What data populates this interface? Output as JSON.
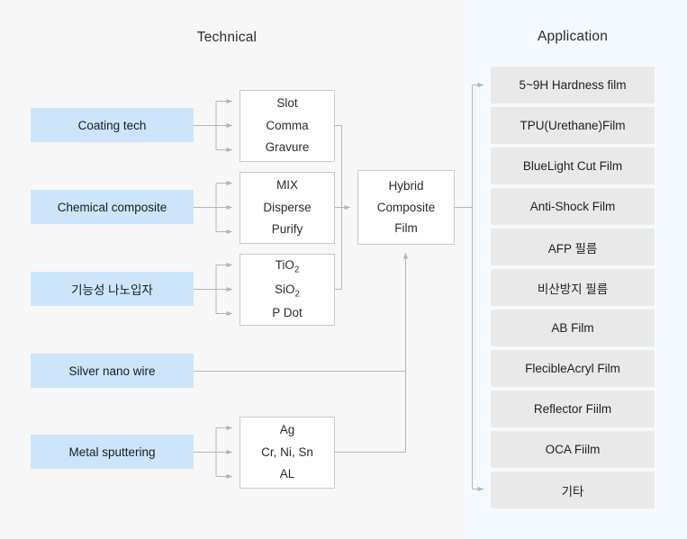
{
  "columns": {
    "technical_title": "Technical",
    "application_title": "Application"
  },
  "colors": {
    "source_box_fill": "#cce5fa",
    "detail_box_fill": "#ffffff",
    "detail_box_border": "#c9c9c9",
    "application_box_fill": "#e9e9e9",
    "left_panel_bg": "#f7f7f7",
    "right_panel_bg": "#f4f9fd",
    "connector_line": "#b5b5b5"
  },
  "sources": [
    {
      "label": "Coating tech"
    },
    {
      "label": "Chemical composite"
    },
    {
      "label": "기능성 나노입자"
    },
    {
      "label": "Silver nano wire"
    },
    {
      "label": "Metal sputtering"
    }
  ],
  "detail_boxes": [
    {
      "lines": [
        "Slot",
        "Comma",
        "Gravure"
      ]
    },
    {
      "lines": [
        "MIX",
        "Disperse",
        "Purify"
      ]
    },
    {
      "lines": [
        "TiO2",
        "SiO2",
        "P Dot"
      ]
    },
    {
      "lines": [
        "Ag",
        "Cr, Ni, Sn",
        "AL"
      ]
    }
  ],
  "hybrid": {
    "lines": [
      "Hybrid",
      "Composite",
      "Film"
    ]
  },
  "applications": [
    {
      "label": "5~9H Hardness film"
    },
    {
      "label": "TPU(Urethane)Film"
    },
    {
      "label": "BlueLight Cut Film"
    },
    {
      "label": "Anti-Shock Film"
    },
    {
      "label": "AFP 필름"
    },
    {
      "label": "비산방지 필름"
    },
    {
      "label": "AB Film"
    },
    {
      "label": "FlecibleAcryl Film"
    },
    {
      "label": "Reflector Fiilm"
    },
    {
      "label": "OCA Fiilm"
    },
    {
      "label": "기타"
    }
  ]
}
